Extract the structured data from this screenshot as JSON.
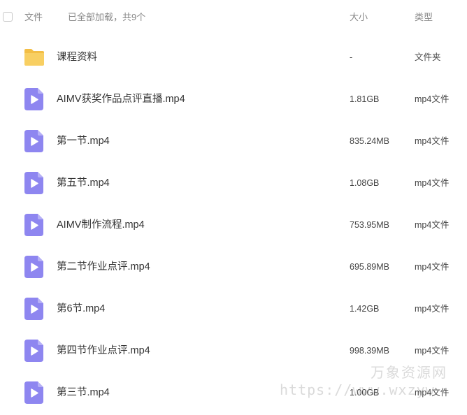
{
  "header": {
    "col_name": "文件",
    "load_status": "已全部加载，共9个",
    "col_size": "大小",
    "col_type": "类型"
  },
  "colors": {
    "folder": "#F8CF62",
    "folder_tab": "#F3BE45",
    "video": "#8E86F0",
    "video_play": "#FFFFFF"
  },
  "files": [
    {
      "icon": "folder-icon",
      "name": "课程资料",
      "size": "-",
      "type": "文件夹"
    },
    {
      "icon": "video-file-icon",
      "name": "AIMV获奖作品点评直播.mp4",
      "size": "1.81GB",
      "type": "mp4文件"
    },
    {
      "icon": "video-file-icon",
      "name": "第一节.mp4",
      "size": "835.24MB",
      "type": "mp4文件"
    },
    {
      "icon": "video-file-icon",
      "name": "第五节.mp4",
      "size": "1.08GB",
      "type": "mp4文件"
    },
    {
      "icon": "video-file-icon",
      "name": "AIMV制作流程.mp4",
      "size": "753.95MB",
      "type": "mp4文件"
    },
    {
      "icon": "video-file-icon",
      "name": "第二节作业点评.mp4",
      "size": "695.89MB",
      "type": "mp4文件"
    },
    {
      "icon": "video-file-icon",
      "name": "第6节.mp4",
      "size": "1.42GB",
      "type": "mp4文件"
    },
    {
      "icon": "video-file-icon",
      "name": "第四节作业点评.mp4",
      "size": "998.39MB",
      "type": "mp4文件"
    },
    {
      "icon": "video-file-icon",
      "name": "第三节.mp4",
      "size": "1.00GB",
      "type": "mp4文件"
    }
  ],
  "watermark": {
    "brand": "万象资源网",
    "url": "https://www.wxzyw"
  }
}
